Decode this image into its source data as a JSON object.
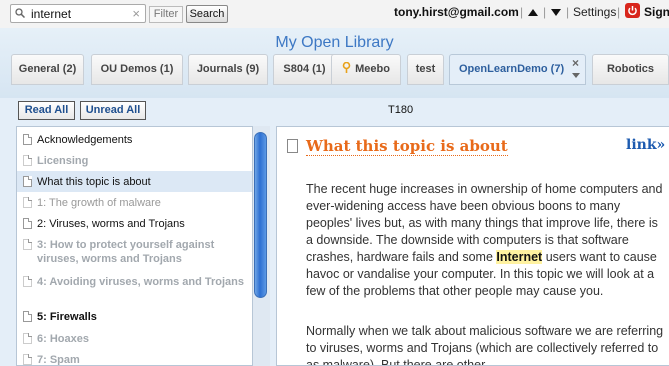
{
  "search": {
    "value": "internet",
    "clear": "×",
    "filter_label": "Filter",
    "search_label": "Search"
  },
  "account": {
    "email": "tony.hirst@gmail.com",
    "divider": "|",
    "settings_label": "Settings",
    "sign_label": "Sign"
  },
  "header": {
    "title": "My Open Library"
  },
  "tabs": [
    {
      "label": "General (2)"
    },
    {
      "label": "OU Demos (1)"
    },
    {
      "label": "Journals (9)"
    },
    {
      "label": "S804 (1)"
    },
    {
      "label": "Meebo",
      "icon": "meebo-icon"
    },
    {
      "label": "test"
    },
    {
      "label": "OpenLearnDemo (7)",
      "close": "×"
    },
    {
      "label": "Robotics"
    }
  ],
  "toolbar": {
    "read_all": "Read All",
    "unread_all": "Unread All"
  },
  "feed": {
    "title": "T180"
  },
  "items": [
    {
      "label": "Acknowledgements"
    },
    {
      "label": "Licensing"
    },
    {
      "label": "What this topic is about"
    },
    {
      "label": "1: The growth of malware"
    },
    {
      "label": "2: Viruses, worms and Trojans"
    },
    {
      "label": "3: How to protect yourself against viruses, worms and Trojans"
    },
    {
      "label": "4: Avoiding viruses, worms and Trojans"
    },
    {
      "label": "5: Firewalls"
    },
    {
      "label": "6: Hoaxes"
    },
    {
      "label": "7: Spam"
    }
  ],
  "article": {
    "title": "What this topic is about",
    "link": "link»",
    "p1_before": "The recent huge increases in ownership of home computers and ever-widening access have been obvious boons to many peoples' lives but, as with many things that improve life, there is a downside. The downside with computers is that software crashes, hardware fails and some ",
    "p1_highlight": "Internet",
    "p1_after": " users want to cause havoc or vandalise your computer. In this topic we will look at a few of the problems that other people may cause you.",
    "p2": "Normally when we talk about malicious software we are referring to viruses, worms and Trojans (which are collectively referred to as malware). But there are other"
  },
  "colors": {
    "accent": "#3d78c4",
    "title_orange": "#e86a1a",
    "link_blue": "#1d5bb0",
    "highlight": "#fff2a0"
  }
}
